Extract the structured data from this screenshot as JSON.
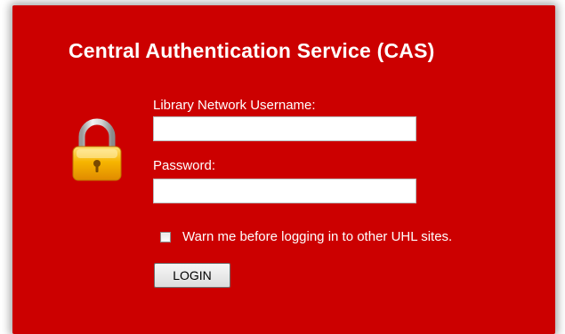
{
  "page": {
    "title": "Central Authentication Service (CAS)"
  },
  "form": {
    "username_label": "Library Network Username:",
    "username_value": "",
    "password_label": "Password:",
    "password_value": "",
    "warn_label": "Warn me before logging in to other UHL sites.",
    "warn_checked": false,
    "login_label": "LOGIN"
  },
  "icons": {
    "lock": "padlock-icon"
  },
  "colors": {
    "panel_background": "#cc0000",
    "text": "#ffffff",
    "lock_body": "#f5b400",
    "lock_shackle": "#c8c8c8"
  }
}
